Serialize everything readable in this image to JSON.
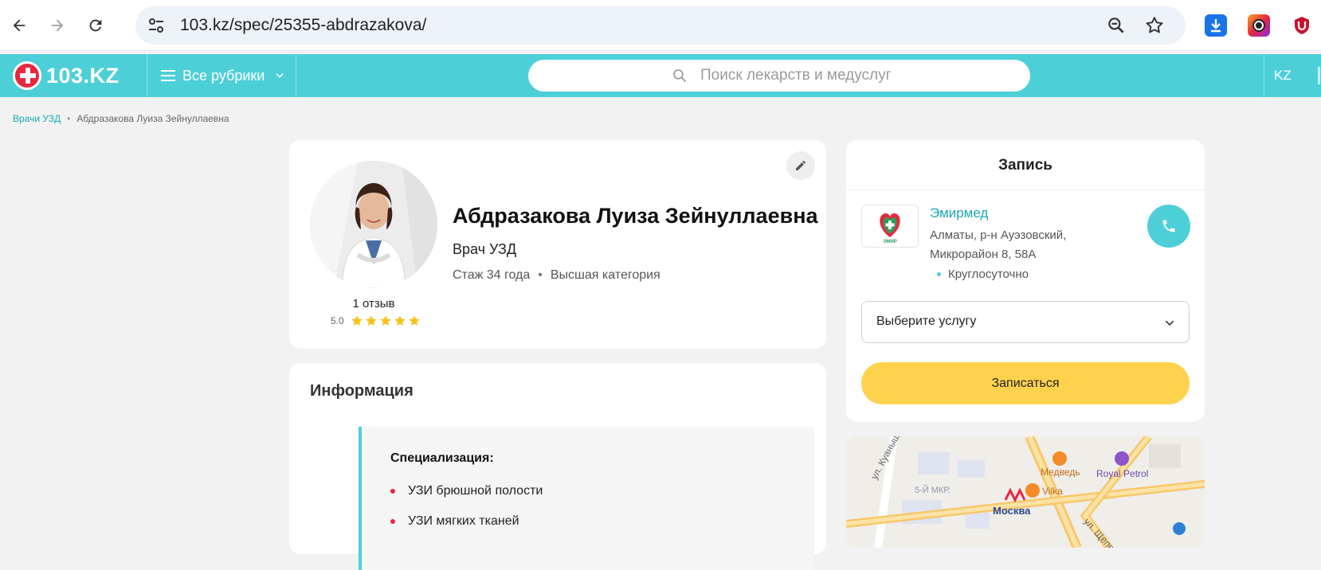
{
  "browser": {
    "url": "103.kz/spec/25355-abdrazakova/"
  },
  "header": {
    "logo_text": "103.KZ",
    "rubrics_label": "Все рубрики",
    "search_placeholder": "Поиск лекарств и медуслуг",
    "lang": "KZ"
  },
  "breadcrumb": {
    "parent": "Врачи УЗД",
    "separator": "•",
    "current": "Абдразакова Луиза Зейнуллаевна"
  },
  "doctor": {
    "name": "Абдразакова Луиза Зейнуллаевна",
    "specialty": "Врач УЗД",
    "experience": "Стаж 34 года",
    "meta_separator": "•",
    "category": "Высшая категория",
    "reviews": "1 отзыв",
    "rating": "5.0",
    "stars": 5
  },
  "info": {
    "title": "Информация",
    "spec_heading": "Специализация:",
    "items": [
      "УЗИ брюшной полости",
      "УЗИ мягких тканей"
    ]
  },
  "booking": {
    "title": "Запись",
    "clinic_name": "Эмирмед",
    "address": "Алматы, р-н Ауэзовский, Микрорайон 8, 58А",
    "hours": "Круглосуточно",
    "service_placeholder": "Выберите услугу",
    "book_button": "Записаться"
  },
  "map": {
    "labels": {
      "street1": "ул. Куанышбаев",
      "district": "5-Й МКР.",
      "metro": "Москва",
      "cafe1": "Медведь",
      "cafe2": "Vilka",
      "petrol": "Royal Petrol",
      "street2": "ул. Щепе"
    }
  },
  "colors": {
    "accent": "#4dcfd8",
    "brand_red": "#e8273f",
    "link": "#1aa7b5",
    "book_button": "#ffd24d",
    "star": "#f7c31c"
  }
}
